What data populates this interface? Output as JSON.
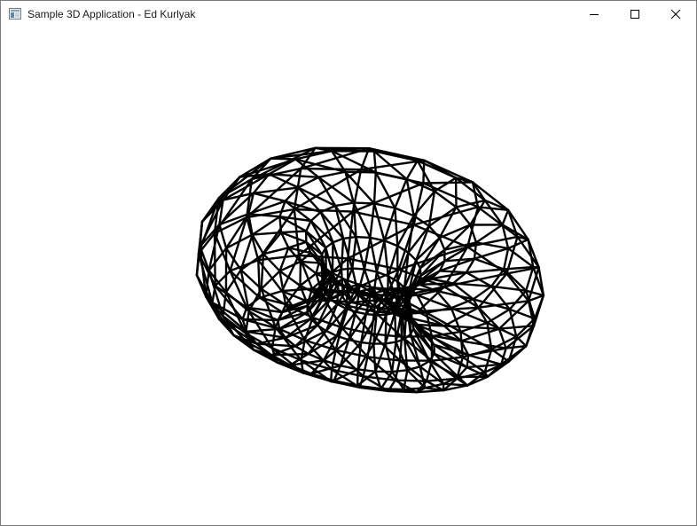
{
  "window": {
    "title": "Sample 3D Application - Ed Kurlyak",
    "controls": {
      "minimize": "minimize",
      "maximize": "maximize",
      "close": "close"
    }
  },
  "icons": {
    "app": "window-app-icon",
    "minimize": "minimize-icon",
    "maximize": "maximize-icon",
    "close": "close-icon"
  },
  "scene": {
    "object": "torus-wireframe",
    "background_color": "#ffffff",
    "line_color": "#000000",
    "major_segments": 24,
    "minor_segments": 12
  }
}
